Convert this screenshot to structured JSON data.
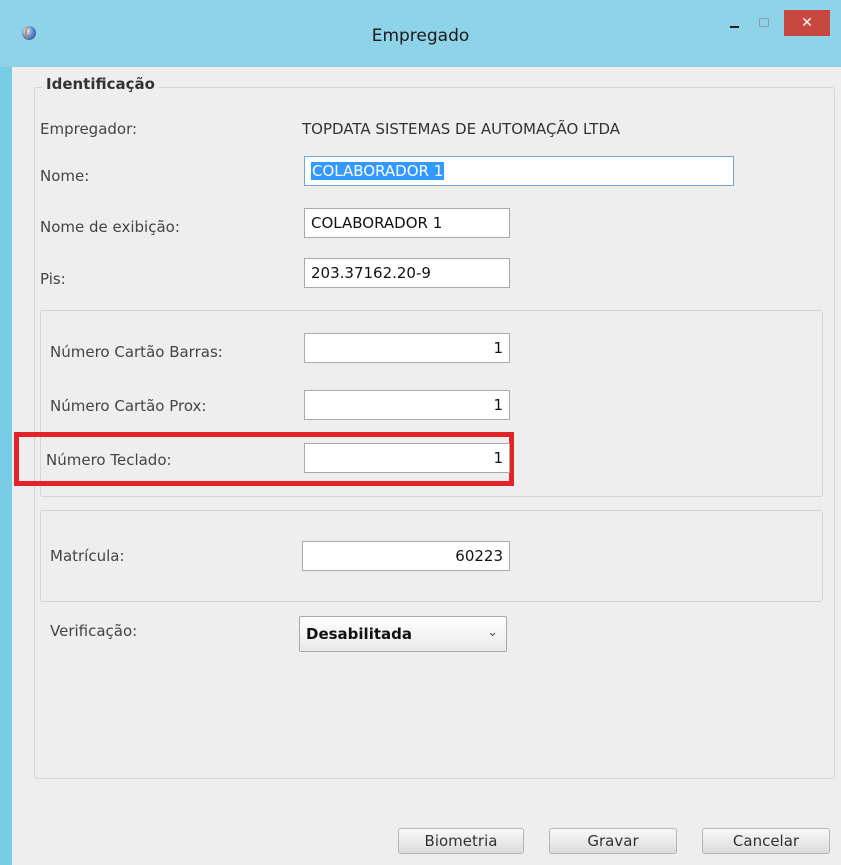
{
  "window": {
    "title": "Empregado",
    "close_glyph": "✕"
  },
  "group": {
    "legend": "Identificação"
  },
  "fields": {
    "empregador": {
      "label": "Empregador:",
      "value": "TOPDATA SISTEMAS DE AUTOMAÇÃO LTDA"
    },
    "nome": {
      "label": "Nome:",
      "value": "COLABORADOR 1"
    },
    "nome_exibicao": {
      "label": "Nome de exibição:",
      "value": "COLABORADOR 1"
    },
    "pis": {
      "label": "Pis:",
      "value": "203.37162.20-9"
    },
    "cartao_barras": {
      "label": "Número Cartão Barras:",
      "value": "1"
    },
    "cartao_prox": {
      "label": "Número Cartão Prox:",
      "value": "1"
    },
    "teclado": {
      "label": "Número Teclado:",
      "value": "1"
    },
    "matricula": {
      "label": "Matrícula:",
      "value": "60223"
    },
    "verificacao": {
      "label": "Verificação:",
      "value": "Desabilitada",
      "arrow": "⌄"
    }
  },
  "buttons": {
    "biometria": "Biometria",
    "gravar": "Gravar",
    "cancelar": "Cancelar"
  },
  "colors": {
    "titlebar": "#8fd3e8",
    "close_button": "#c7483f",
    "highlight": "#e2232a",
    "selection": "#3399ff"
  },
  "icons": [
    "app-icon",
    "minimize-icon",
    "maximize-icon",
    "close-icon",
    "chevron-down-icon"
  ]
}
